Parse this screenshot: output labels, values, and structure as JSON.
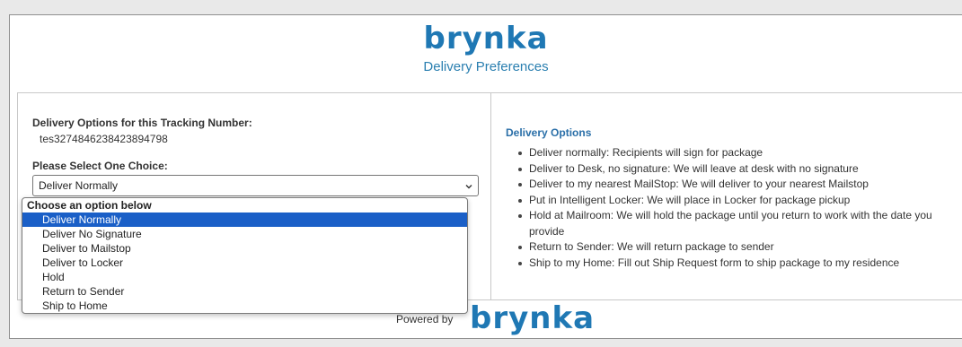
{
  "colors": {
    "brand": "#1f78b4",
    "subtitle": "#2a7fb0",
    "options_title": "#2a6fa8",
    "selected_option_bg": "#1a5fc7"
  },
  "header": {
    "logo_text": "brynka",
    "subtitle": "Delivery Preferences"
  },
  "left_panel": {
    "tracking_label": "Delivery Options for this Tracking Number:",
    "tracking_number": "tes3274846238423894798",
    "choice_label": "Please Select One Choice:",
    "select": {
      "value": "Deliver Normally",
      "icon": "chevron-down-icon"
    },
    "dropdown": {
      "group_label": "Choose an option below",
      "options": [
        "Deliver Normally",
        "Deliver No Signature",
        "Deliver to Mailstop",
        "Deliver to Locker",
        "Hold",
        "Return to Sender",
        "Ship to Home"
      ],
      "selected_index": 0
    }
  },
  "right_panel": {
    "title": "Delivery Options",
    "items": [
      "Deliver normally: Recipients will sign for package",
      "Deliver to Desk, no signature: We will leave at desk with no signature",
      "Deliver to my nearest MailStop: We will deliver to your nearest Mailstop",
      "Put in Intelligent Locker: We will place in Locker for package pickup",
      "Hold at Mailroom: We will hold the package until you return to work with the date you provide",
      "Return to Sender: We will return package to sender",
      "Ship to my Home: Fill out Ship Request form to ship package to my residence"
    ]
  },
  "footer": {
    "powered_by": "Powered by",
    "logo_text": "brynka"
  }
}
